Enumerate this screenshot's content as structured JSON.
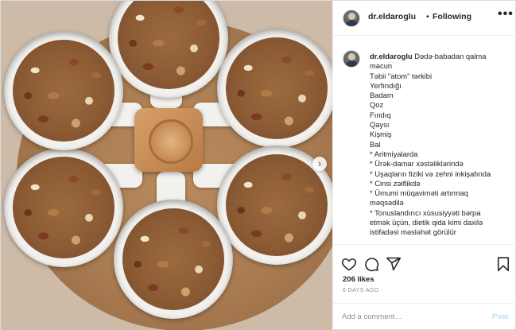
{
  "post": {
    "author": "dr.eldaroglu",
    "separator": "•",
    "follow_status": "Following",
    "more_icon": "more-horizontal-icon",
    "caption_lines": [
      "Dədə-babadan qalma",
      "macun",
      "Təbii \"atom\" tərkibi",
      "Yerfındığı",
      "Badam",
      "Qoz",
      "Fındıq",
      "Qaysı",
      "Kişmiş",
      "Bal",
      "* Aritmiyalarda",
      "* Ürək-damar xəstəliklərində",
      "* Uşaqların fiziki və zehni inkişafında",
      "* Cinsi zəiflikdə",
      "* Ümumi müqaviməti artırmaq",
      "məqsədilə",
      "* Tonuslandırıcı xüsusiyyəti bərpa",
      "etmək üçün, dietik qida kimi daxilə",
      "istifadəsi məsləhət görülür"
    ],
    "likes": "206 likes",
    "timestamp": "6 DAYS AGO",
    "comment_placeholder": "Add a comment…",
    "post_button": "Post"
  }
}
